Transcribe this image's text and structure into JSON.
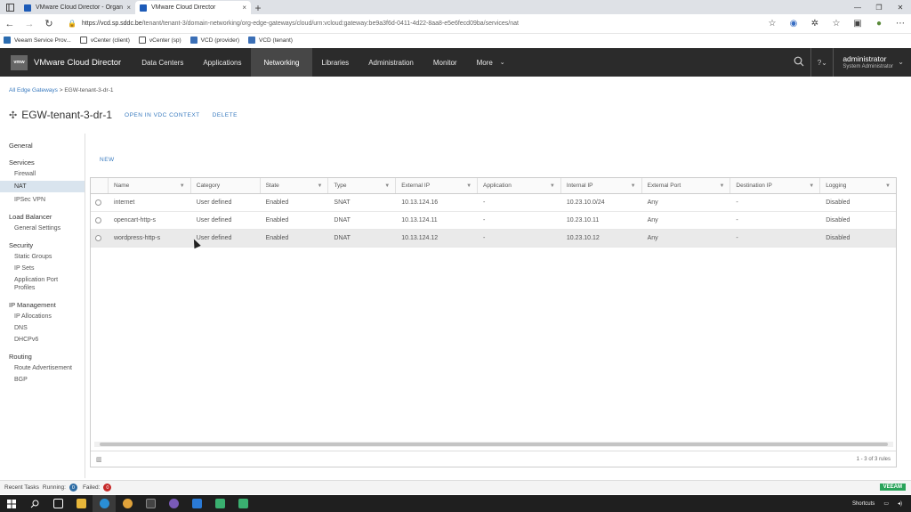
{
  "browser": {
    "tabs": [
      {
        "title": "VMware Cloud Director - Organ",
        "close": "×"
      },
      {
        "title": "VMware Cloud Director",
        "close": "×"
      }
    ],
    "new_tab": "+",
    "url_host": "https://vcd.sp.sddc.be",
    "url_path": "/tenant/tenant-3/domain-networking/org-edge-gateways/cloud/urn:vcloud:gateway:be9a3f6d-0411-4d22-8aa8-e5e6fecd09ba/services/nat",
    "bookmarks": [
      {
        "label": "Veeam Service Prov...",
        "icon": "veeam-icon"
      },
      {
        "label": "vCenter (client)",
        "icon": "file-icon"
      },
      {
        "label": "vCenter (sp)",
        "icon": "file-icon"
      },
      {
        "label": "VCD (provider)",
        "icon": "vcd-icon"
      },
      {
        "label": "VCD (tenant)",
        "icon": "vcd-icon"
      }
    ]
  },
  "app": {
    "logo": "vmw",
    "name": "VMware Cloud Director",
    "nav": [
      "Data Centers",
      "Applications",
      "Networking",
      "Libraries",
      "Administration",
      "Monitor",
      "More"
    ],
    "active_nav": "Networking",
    "user": {
      "name": "administrator",
      "role": "System Administrator"
    }
  },
  "breadcrumb": {
    "link": "All Edge Gateways",
    "sep": ">",
    "current": "EGW-tenant-3-dr-1"
  },
  "page": {
    "title": "EGW-tenant-3-dr-1",
    "actions": {
      "open_vdc": "OPEN IN VDC CONTEXT",
      "delete": "DELETE"
    }
  },
  "sidenav": {
    "general": "General",
    "services": {
      "label": "Services",
      "items": [
        "Firewall",
        "NAT",
        "IPSec VPN"
      ]
    },
    "load_balancer": {
      "label": "Load Balancer",
      "items": [
        "General Settings"
      ]
    },
    "security": {
      "label": "Security",
      "items": [
        "Static Groups",
        "IP Sets",
        "Application Port Profiles"
      ]
    },
    "ip_management": {
      "label": "IP Management",
      "items": [
        "IP Allocations",
        "DNS",
        "DHCPv6"
      ]
    },
    "routing": {
      "label": "Routing",
      "items": [
        "Route Advertisement",
        "BGP"
      ]
    },
    "selected": "NAT"
  },
  "nat": {
    "new_label": "NEW",
    "columns": [
      "Name",
      "Category",
      "State",
      "Type",
      "External IP",
      "Application",
      "Internal IP",
      "External Port",
      "Destination IP",
      "Logging"
    ],
    "rows": [
      [
        "internet",
        "User defined",
        "Enabled",
        "SNAT",
        "10.13.124.16",
        "-",
        "10.23.10.0/24",
        "Any",
        "-",
        "Disabled"
      ],
      [
        "opencart-http-s",
        "User defined",
        "Enabled",
        "DNAT",
        "10.13.124.11",
        "-",
        "10.23.10.11",
        "Any",
        "-",
        "Disabled"
      ],
      [
        "wordpress-http-s",
        "User defined",
        "Enabled",
        "DNAT",
        "10.13.124.12",
        "-",
        "10.23.10.12",
        "Any",
        "-",
        "Disabled"
      ]
    ],
    "footer_count": "1 - 3 of 3 rules"
  },
  "tasks": {
    "recent": "Recent Tasks",
    "running_label": "Running:",
    "running": "0",
    "failed_label": "Failed:",
    "failed": "0",
    "veeam": "VEEAM"
  },
  "windows": {
    "shortcuts": "Shortcuts"
  },
  "colors": {
    "header_bg": "#2b2b2b",
    "accent": "#3a7bbf",
    "selected_nav": "#d9e4ee"
  }
}
